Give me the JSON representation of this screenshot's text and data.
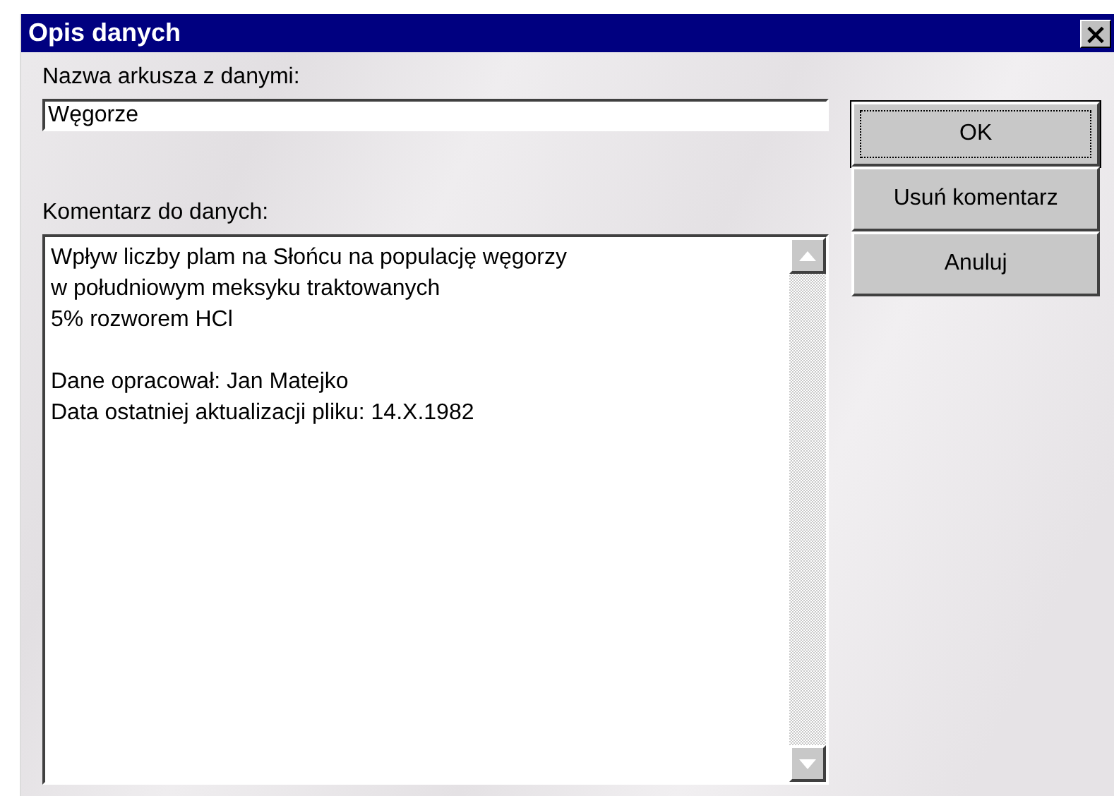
{
  "window": {
    "title": "Opis danych",
    "close": "×"
  },
  "name_field": {
    "label": "Nazwa arkusza z danymi:",
    "value": "Węgorze"
  },
  "comment_field": {
    "label": "Komentarz do danych:",
    "paragraphs": [
      [
        "Wpływ liczby plam na Słońcu na populację węgorzy",
        "w południowym meksyku traktowanych",
        "5% rozworem HCl"
      ],
      [
        "Dane opracował: Jan Matejko",
        "Data ostatniej aktualizacji pliku: 14.X.1982"
      ]
    ]
  },
  "buttons": [
    {
      "label": "OK",
      "default": true
    },
    {
      "label": "Usuń komentarz",
      "default": false
    },
    {
      "label": "Anuluj",
      "default": false
    }
  ]
}
